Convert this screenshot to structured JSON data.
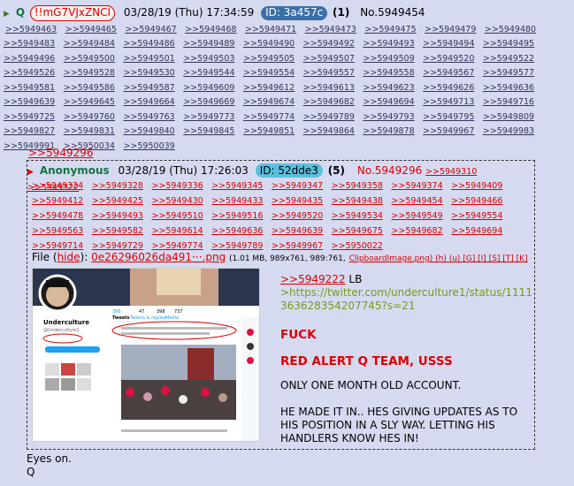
{
  "header": {
    "name": "Q",
    "tripcode": "!!mG7VJxZNCI",
    "datetime": "03/28/19 (Thu) 17:34:59",
    "id": "ID: 3a457c",
    "count": "(1)",
    "post_no": "No.5949454",
    "refs": [
      ">>5949463",
      ">>5949465",
      ">>5949467",
      ">>5949468",
      ">>5949471",
      ">>5949473",
      ">>5949475",
      ">>5949479",
      ">>5949480",
      ">>5949483",
      ">>5949484",
      ">>5949486",
      ">>5949489",
      ">>5949490",
      ">>5949492",
      ">>5949493",
      ">>5949494",
      ">>5949495",
      ">>5949496",
      ">>5949500",
      ">>5949501",
      ">>5949503",
      ">>5949505",
      ">>5949507",
      ">>5949509",
      ">>5949520",
      ">>5949522",
      ">>5949526",
      ">>5949528",
      ">>5949530",
      ">>5949544",
      ">>5949554",
      ">>5949557",
      ">>5949558",
      ">>5949567",
      ">>5949577",
      ">>5949581",
      ">>5949586",
      ">>5949587",
      ">>5949609",
      ">>5949612",
      ">>5949613",
      ">>5949623",
      ">>5949626",
      ">>5949636",
      ">>5949639",
      ">>5949645",
      ">>5949664",
      ">>5949669",
      ">>5949674",
      ">>5949682",
      ">>5949694",
      ">>5949713",
      ">>5949716",
      ">>5949725",
      ">>5949760",
      ">>5949763",
      ">>5949773",
      ">>5949774",
      ">>5949789",
      ">>5949793",
      ">>5949795",
      ">>5949809",
      ">>5949827",
      ">>5949831",
      ">>5949840",
      ">>5949845",
      ">>5949851",
      ">>5949864",
      ">>5949878",
      ">>5949967",
      ">>5949983",
      ">>5949991",
      ">>5950034",
      ">>5950039"
    ]
  },
  "quote_link": ">>5949296",
  "inline_post": {
    "name": "Anonymous",
    "datetime": "03/28/19 (Thu) 17:26:03",
    "id": "ID: 52dde3",
    "count": "(5)",
    "post_no": "No.5949296",
    "refs": [
      ">>5949310",
      ">>5949322",
      ">>5949324",
      ">>5949328",
      ">>5949336",
      ">>5949345",
      ">>5949347",
      ">>5949358",
      ">>5949374",
      ">>5949409",
      ">>5949412",
      ">>5949425",
      ">>5949430",
      ">>5949433",
      ">>5949435",
      ">>5949438",
      ">>5949454",
      ">>5949466",
      ">>5949478",
      ">>5949493",
      ">>5949510",
      ">>5949516",
      ">>5949520",
      ">>5949534",
      ">>5949549",
      ">>5949554",
      ">>5949563",
      ">>5949582",
      ">>5949614",
      ">>5949636",
      ">>5949639",
      ">>5949675",
      ">>5949682",
      ">>5949694",
      ">>5949714",
      ">>5949729",
      ">>5949774",
      ">>5949789",
      ">>5949967",
      ">>5950022"
    ],
    "file_label": "File (",
    "hide": "hide",
    "file_close": "):",
    "filename": "0e26296026da491···.png",
    "file_meta": "(1.01 MB, 989x761, 989:761,",
    "file_orig": "ClipboardImage.png",
    "file_tools": ") (h) (u) [G] [I] [S] [T] [K]",
    "thumb": {
      "profile_name": "Underculture",
      "handle": "@Underculture1",
      "tabs": [
        "Tweets",
        "Tweets & replies",
        "Media"
      ],
      "stats": [
        "398",
        "47",
        "398",
        "737"
      ]
    },
    "body": {
      "quote": ">>5949222",
      "quote_suffix": " LB",
      "url": ">https://twitter.com/underculture1/status/1111363628354207745?s=21",
      "line1": "FUCK",
      "line2": "RED ALERT Q TEAM, USSS",
      "line3": "ONLY ONE MONTH OLD ACCOUNT.",
      "line4": "HE MADE IT IN.. HES GIVING UPDATES AS TO HIS POSITION IN A SLY WAY. LETTING HIS HANDLERS KNOW HES IN!"
    }
  },
  "tail": [
    "Eyes on.",
    "Q"
  ],
  "colors": {
    "bg": "#d6daf0",
    "link": "#34345c",
    "red": "#dd0000",
    "name_green": "#117743",
    "greentext": "#789922"
  }
}
